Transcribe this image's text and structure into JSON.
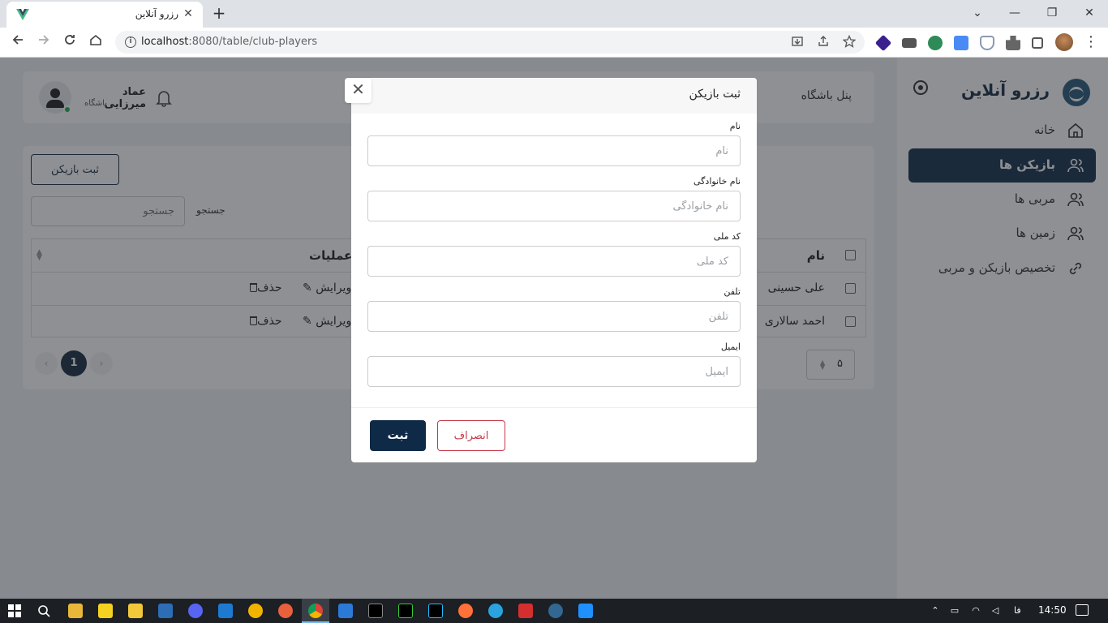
{
  "browser": {
    "tab_title": "رزرو آنلاین",
    "tab_close": "✕",
    "new_tab": "+",
    "url_host": "localhost",
    "url_path": ":8080/table/club-players",
    "window_controls": [
      "⌄",
      "—",
      "❐",
      "✕"
    ]
  },
  "sidebar": {
    "brand": "رزرو آنلاین",
    "items": [
      {
        "label": "خانه",
        "icon": "home-icon",
        "active": false
      },
      {
        "label": "بازیکن ها",
        "icon": "users-icon",
        "active": true
      },
      {
        "label": "مربی ها",
        "icon": "users-icon",
        "active": false
      },
      {
        "label": "زمین ها",
        "icon": "users-icon",
        "active": false
      },
      {
        "label": "تخصیص بازیکن و مربی",
        "icon": "link-icon",
        "active": false
      }
    ]
  },
  "header": {
    "panel_title": "پنل باشگاه",
    "user_name": "عماد میرزایی",
    "user_role": "باشگاه"
  },
  "content": {
    "add_button": "ثبت بازیکن",
    "search_label": "جستجو",
    "search_placeholder": "جستجو",
    "table": {
      "col_name": "نام",
      "col_ops": "عملیات",
      "rows": [
        {
          "name": "علی حسینی",
          "edit": "ویرایش",
          "delete": "حذف"
        },
        {
          "name": "احمد سالاری",
          "edit": "ویرایش",
          "delete": "حذف"
        }
      ]
    },
    "pagination": {
      "current": "1",
      "page_size": "۵"
    }
  },
  "modal": {
    "title": "ثبت بازیکن",
    "close": "✕",
    "fields": [
      {
        "label": "نام",
        "placeholder": "نام",
        "value": ""
      },
      {
        "label": "نام خانوادگی",
        "placeholder": "نام خانوادگی",
        "value": ""
      },
      {
        "label": "کد ملی",
        "placeholder": "کد ملی",
        "value": ""
      },
      {
        "label": "تلفن",
        "placeholder": "تلفن",
        "value": ""
      },
      {
        "label": "ایمیل",
        "placeholder": "ایمیل",
        "value": ""
      }
    ],
    "submit": "ثبت",
    "cancel": "انصراف"
  },
  "taskbar": {
    "lang": "فا",
    "time": "14:50"
  },
  "colors": {
    "brand_dark": "#17324f",
    "submit_bg": "#0f2a47",
    "cancel_accent": "#c53a4a",
    "online_status": "#22b14c"
  }
}
